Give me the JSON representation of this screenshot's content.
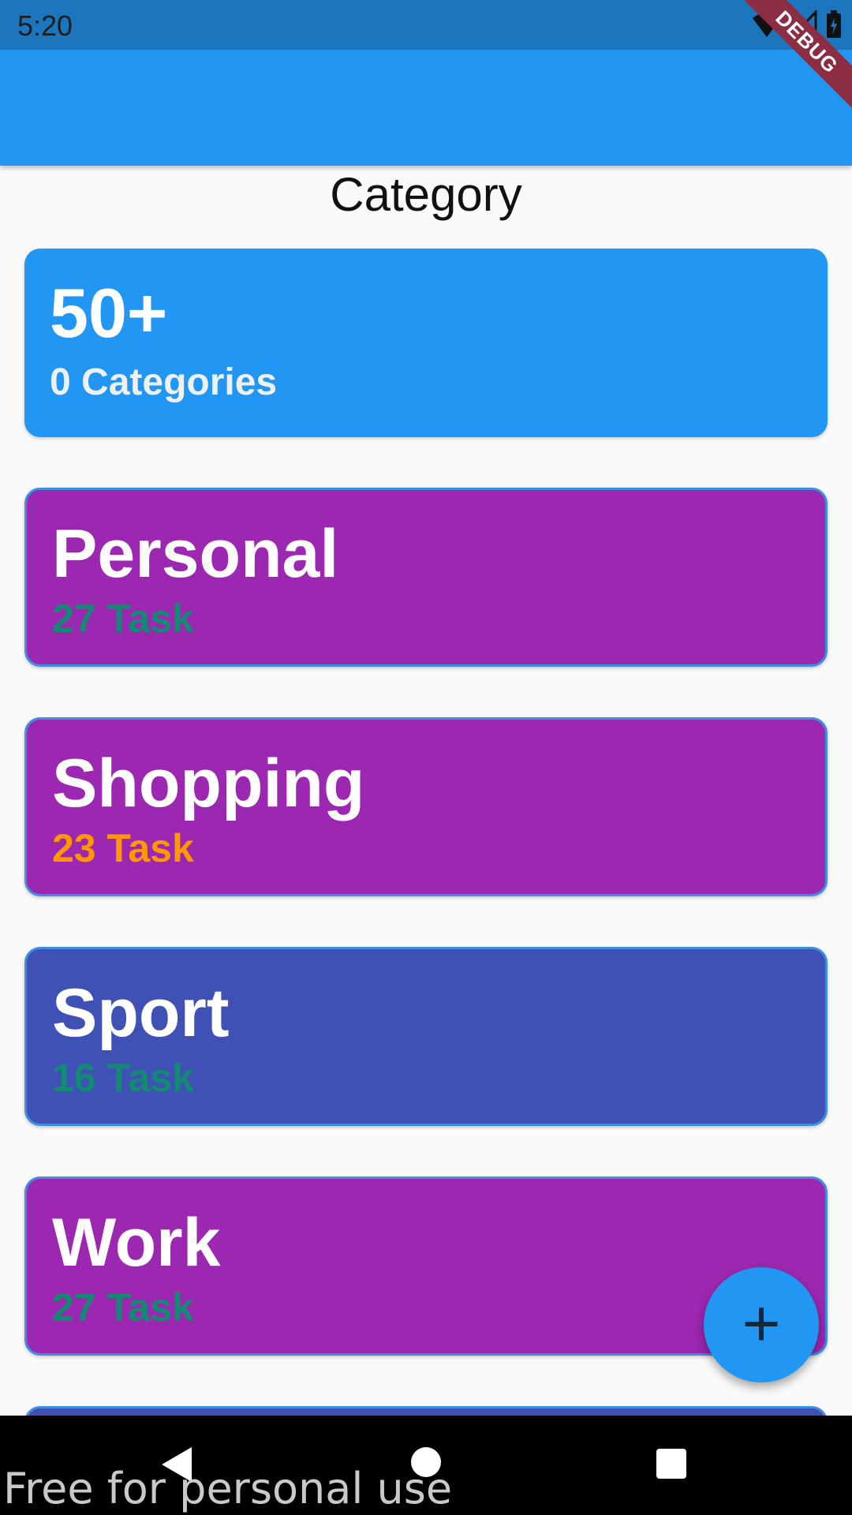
{
  "status_bar": {
    "time": "5:20"
  },
  "debug_banner": "DEBUG",
  "page": {
    "title": "Category"
  },
  "summary": {
    "count": "50+",
    "label": "0 Categories"
  },
  "categories": [
    {
      "name": "Personal",
      "count": "27 Task",
      "bg": "#9c27b0",
      "count_color": "#138a74"
    },
    {
      "name": "Shopping",
      "count": "23 Task",
      "bg": "#9c27b0",
      "count_color": "#ff9800"
    },
    {
      "name": "Sport",
      "count": "16 Task",
      "bg": "#3f51b5",
      "count_color": "#138a74"
    },
    {
      "name": "Work",
      "count": "27 Task",
      "bg": "#9c27b0",
      "count_color": "#138a74"
    }
  ],
  "fab": {
    "label": "+"
  },
  "watermark": "Free for personal use",
  "colors": {
    "accent": "#2196f3",
    "status_bar": "#1b76bd"
  }
}
